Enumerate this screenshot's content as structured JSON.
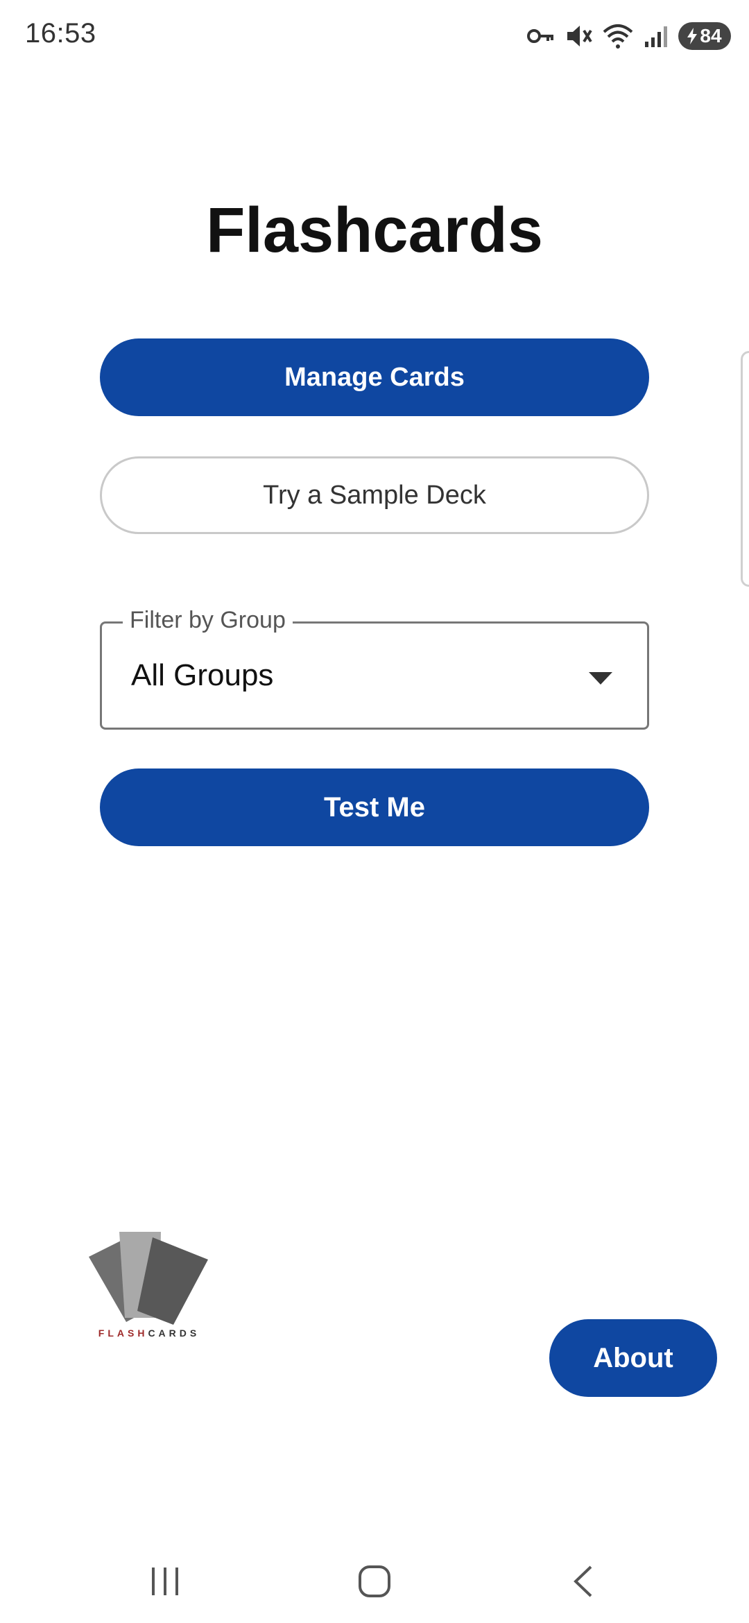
{
  "status_bar": {
    "time": "16:53",
    "battery": "84",
    "icons": [
      "vpn-key-icon",
      "vibrate-mute-icon",
      "wifi-icon",
      "signal-icon",
      "battery-charging-icon"
    ]
  },
  "title": "Flashcards",
  "buttons": {
    "manage": "Manage Cards",
    "sample": "Try a Sample Deck",
    "test": "Test Me",
    "about": "About"
  },
  "filter": {
    "label": "Filter by Group",
    "value": "All Groups"
  },
  "logo": {
    "text_part1": "FLASH",
    "text_part2": "CARDS"
  },
  "colors": {
    "primary": "#0f47a1",
    "outline": "#c9c9c9",
    "text": "#111111"
  },
  "nav": [
    "recent-apps-icon",
    "home-icon",
    "back-icon"
  ]
}
